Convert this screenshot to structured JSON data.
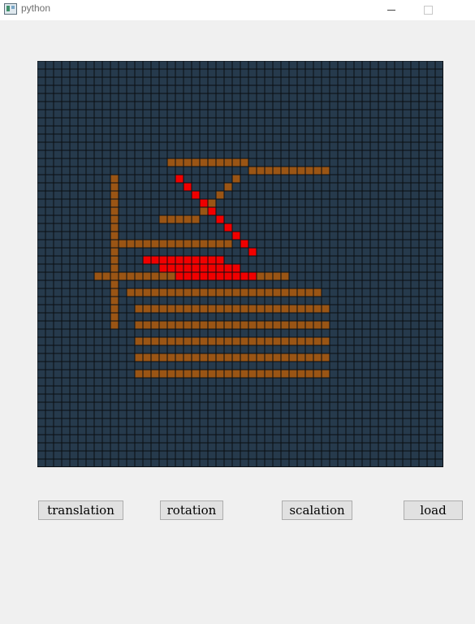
{
  "window": {
    "title": "python",
    "icon": "python-window-icon"
  },
  "colors": {
    "background": "#f0f0f0",
    "grid_cell": "#263a4c",
    "grid_line": "#0b0e12",
    "fill_brown": "#9a5515",
    "fill_red": "#f00000"
  },
  "grid": {
    "cols": 50,
    "rows": 50,
    "brown_cells": [
      [
        16,
        12
      ],
      [
        17,
        12
      ],
      [
        18,
        12
      ],
      [
        19,
        12
      ],
      [
        20,
        12
      ],
      [
        21,
        12
      ],
      [
        22,
        12
      ],
      [
        23,
        12
      ],
      [
        24,
        12
      ],
      [
        25,
        12
      ],
      [
        26,
        13
      ],
      [
        27,
        13
      ],
      [
        28,
        13
      ],
      [
        29,
        13
      ],
      [
        30,
        13
      ],
      [
        31,
        13
      ],
      [
        32,
        13
      ],
      [
        33,
        13
      ],
      [
        34,
        13
      ],
      [
        35,
        13
      ],
      [
        9,
        14
      ],
      [
        9,
        15
      ],
      [
        9,
        16
      ],
      [
        9,
        17
      ],
      [
        9,
        18
      ],
      [
        9,
        19
      ],
      [
        9,
        20
      ],
      [
        9,
        21
      ],
      [
        9,
        22
      ],
      [
        9,
        23
      ],
      [
        9,
        24
      ],
      [
        9,
        25
      ],
      [
        9,
        26
      ],
      [
        9,
        27
      ],
      [
        9,
        28
      ],
      [
        9,
        29
      ],
      [
        9,
        30
      ],
      [
        9,
        31
      ],
      [
        9,
        32
      ],
      [
        15,
        19
      ],
      [
        16,
        19
      ],
      [
        17,
        19
      ],
      [
        18,
        19
      ],
      [
        19,
        19
      ],
      [
        20,
        18
      ],
      [
        21,
        17
      ],
      [
        22,
        16
      ],
      [
        23,
        15
      ],
      [
        24,
        14
      ],
      [
        10,
        22
      ],
      [
        11,
        22
      ],
      [
        12,
        22
      ],
      [
        13,
        22
      ],
      [
        14,
        22
      ],
      [
        15,
        22
      ],
      [
        16,
        22
      ],
      [
        17,
        22
      ],
      [
        18,
        22
      ],
      [
        19,
        22
      ],
      [
        20,
        22
      ],
      [
        21,
        22
      ],
      [
        22,
        22
      ],
      [
        23,
        22
      ],
      [
        7,
        26
      ],
      [
        8,
        26
      ],
      [
        9,
        26
      ],
      [
        10,
        26
      ],
      [
        11,
        26
      ],
      [
        12,
        26
      ],
      [
        13,
        26
      ],
      [
        14,
        26
      ],
      [
        15,
        26
      ],
      [
        16,
        26
      ],
      [
        17,
        26
      ],
      [
        18,
        26
      ],
      [
        19,
        26
      ],
      [
        20,
        26
      ],
      [
        21,
        26
      ],
      [
        22,
        26
      ],
      [
        23,
        26
      ],
      [
        24,
        26
      ],
      [
        25,
        26
      ],
      [
        26,
        26
      ],
      [
        27,
        26
      ],
      [
        28,
        26
      ],
      [
        29,
        26
      ],
      [
        30,
        26
      ],
      [
        11,
        28
      ],
      [
        12,
        28
      ],
      [
        13,
        28
      ],
      [
        14,
        28
      ],
      [
        15,
        28
      ],
      [
        16,
        28
      ],
      [
        17,
        28
      ],
      [
        18,
        28
      ],
      [
        19,
        28
      ],
      [
        20,
        28
      ],
      [
        21,
        28
      ],
      [
        22,
        28
      ],
      [
        23,
        28
      ],
      [
        24,
        28
      ],
      [
        25,
        28
      ],
      [
        26,
        28
      ],
      [
        27,
        28
      ],
      [
        28,
        28
      ],
      [
        29,
        28
      ],
      [
        30,
        28
      ],
      [
        31,
        28
      ],
      [
        32,
        28
      ],
      [
        33,
        28
      ],
      [
        34,
        28
      ],
      [
        12,
        30
      ],
      [
        13,
        30
      ],
      [
        14,
        30
      ],
      [
        15,
        30
      ],
      [
        16,
        30
      ],
      [
        17,
        30
      ],
      [
        18,
        30
      ],
      [
        19,
        30
      ],
      [
        20,
        30
      ],
      [
        21,
        30
      ],
      [
        22,
        30
      ],
      [
        23,
        30
      ],
      [
        24,
        30
      ],
      [
        25,
        30
      ],
      [
        26,
        30
      ],
      [
        27,
        30
      ],
      [
        28,
        30
      ],
      [
        29,
        30
      ],
      [
        30,
        30
      ],
      [
        31,
        30
      ],
      [
        32,
        30
      ],
      [
        33,
        30
      ],
      [
        34,
        30
      ],
      [
        35,
        30
      ],
      [
        12,
        32
      ],
      [
        13,
        32
      ],
      [
        14,
        32
      ],
      [
        15,
        32
      ],
      [
        16,
        32
      ],
      [
        17,
        32
      ],
      [
        18,
        32
      ],
      [
        19,
        32
      ],
      [
        20,
        32
      ],
      [
        21,
        32
      ],
      [
        22,
        32
      ],
      [
        23,
        32
      ],
      [
        24,
        32
      ],
      [
        25,
        32
      ],
      [
        26,
        32
      ],
      [
        27,
        32
      ],
      [
        28,
        32
      ],
      [
        29,
        32
      ],
      [
        30,
        32
      ],
      [
        31,
        32
      ],
      [
        32,
        32
      ],
      [
        33,
        32
      ],
      [
        34,
        32
      ],
      [
        35,
        32
      ],
      [
        12,
        34
      ],
      [
        13,
        34
      ],
      [
        14,
        34
      ],
      [
        15,
        34
      ],
      [
        16,
        34
      ],
      [
        17,
        34
      ],
      [
        18,
        34
      ],
      [
        19,
        34
      ],
      [
        20,
        34
      ],
      [
        21,
        34
      ],
      [
        22,
        34
      ],
      [
        23,
        34
      ],
      [
        24,
        34
      ],
      [
        25,
        34
      ],
      [
        26,
        34
      ],
      [
        27,
        34
      ],
      [
        28,
        34
      ],
      [
        29,
        34
      ],
      [
        30,
        34
      ],
      [
        31,
        34
      ],
      [
        32,
        34
      ],
      [
        33,
        34
      ],
      [
        34,
        34
      ],
      [
        35,
        34
      ],
      [
        12,
        36
      ],
      [
        13,
        36
      ],
      [
        14,
        36
      ],
      [
        15,
        36
      ],
      [
        16,
        36
      ],
      [
        17,
        36
      ],
      [
        18,
        36
      ],
      [
        19,
        36
      ],
      [
        20,
        36
      ],
      [
        21,
        36
      ],
      [
        22,
        36
      ],
      [
        23,
        36
      ],
      [
        24,
        36
      ],
      [
        25,
        36
      ],
      [
        26,
        36
      ],
      [
        27,
        36
      ],
      [
        28,
        36
      ],
      [
        29,
        36
      ],
      [
        30,
        36
      ],
      [
        31,
        36
      ],
      [
        32,
        36
      ],
      [
        33,
        36
      ],
      [
        34,
        36
      ],
      [
        35,
        36
      ],
      [
        12,
        38
      ],
      [
        13,
        38
      ],
      [
        14,
        38
      ],
      [
        15,
        38
      ],
      [
        16,
        38
      ],
      [
        17,
        38
      ],
      [
        18,
        38
      ],
      [
        19,
        38
      ],
      [
        20,
        38
      ],
      [
        21,
        38
      ],
      [
        22,
        38
      ],
      [
        23,
        38
      ],
      [
        24,
        38
      ],
      [
        25,
        38
      ],
      [
        26,
        38
      ],
      [
        27,
        38
      ],
      [
        28,
        38
      ],
      [
        29,
        38
      ],
      [
        30,
        38
      ],
      [
        31,
        38
      ],
      [
        32,
        38
      ],
      [
        33,
        38
      ],
      [
        34,
        38
      ],
      [
        35,
        38
      ]
    ],
    "red_cells": [
      [
        17,
        14
      ],
      [
        18,
        15
      ],
      [
        19,
        16
      ],
      [
        20,
        17
      ],
      [
        21,
        18
      ],
      [
        22,
        19
      ],
      [
        23,
        20
      ],
      [
        24,
        21
      ],
      [
        25,
        22
      ],
      [
        26,
        23
      ],
      [
        13,
        24
      ],
      [
        14,
        24
      ],
      [
        15,
        24
      ],
      [
        16,
        24
      ],
      [
        17,
        24
      ],
      [
        18,
        24
      ],
      [
        19,
        24
      ],
      [
        20,
        24
      ],
      [
        21,
        24
      ],
      [
        22,
        24
      ],
      [
        15,
        25
      ],
      [
        16,
        25
      ],
      [
        17,
        25
      ],
      [
        18,
        25
      ],
      [
        19,
        25
      ],
      [
        20,
        25
      ],
      [
        21,
        25
      ],
      [
        22,
        25
      ],
      [
        23,
        25
      ],
      [
        24,
        25
      ],
      [
        17,
        26
      ],
      [
        18,
        26
      ],
      [
        19,
        26
      ],
      [
        20,
        26
      ],
      [
        21,
        26
      ],
      [
        22,
        26
      ],
      [
        23,
        26
      ],
      [
        24,
        26
      ],
      [
        25,
        26
      ],
      [
        26,
        26
      ]
    ]
  },
  "buttons": {
    "translation": "translation",
    "rotation": "rotation",
    "scalation": "scalation",
    "load": "load"
  }
}
